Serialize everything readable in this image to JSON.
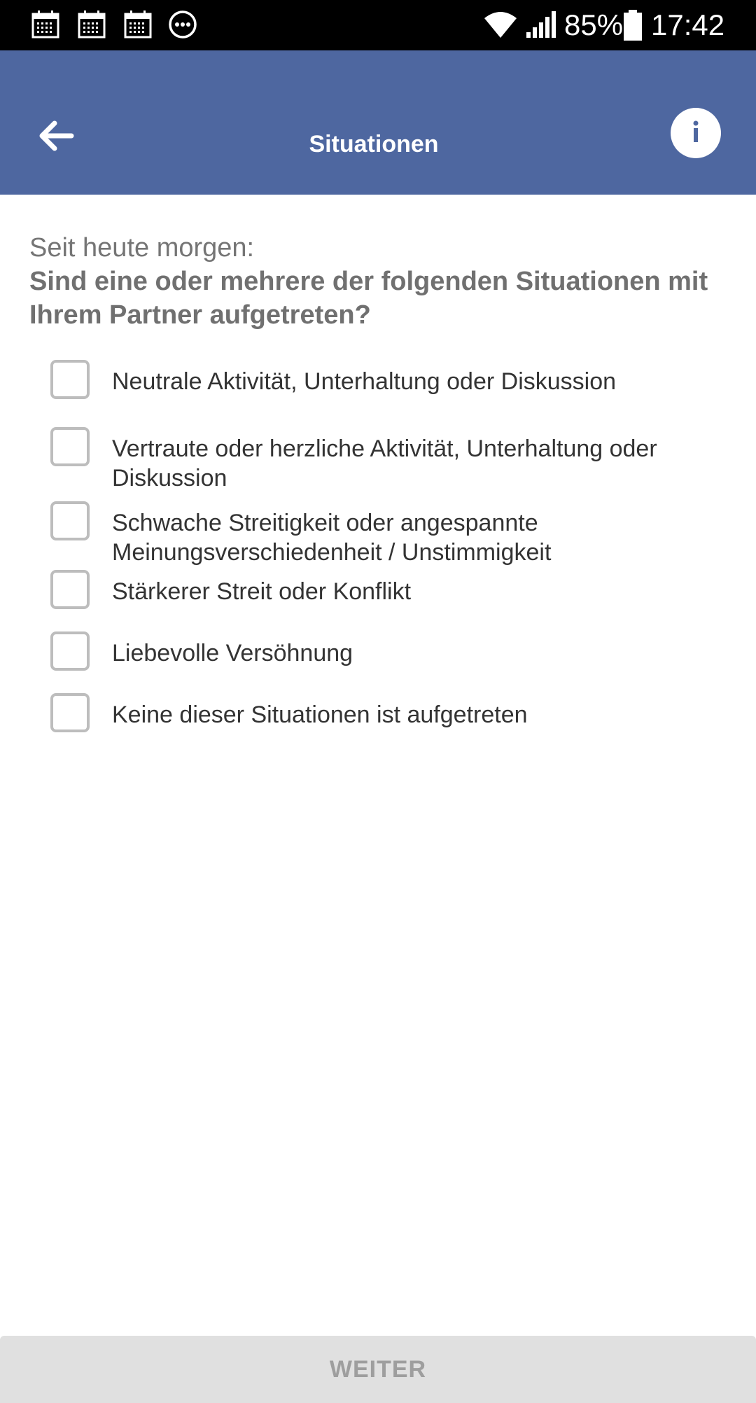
{
  "status_bar": {
    "battery_percent": "85%",
    "time": "17:42",
    "left_icons": [
      "calendar-icon",
      "calendar-icon",
      "calendar-icon",
      "more-dots-icon"
    ],
    "right_icons": [
      "wifi-icon",
      "signal-icon",
      "battery-icon"
    ]
  },
  "app_bar": {
    "title": "Situationen",
    "back_icon": "arrow-left-icon",
    "info_icon": "info-icon",
    "color": "#4e67a0"
  },
  "question": {
    "prefix": "Seit heute morgen:",
    "text": "Sind eine oder mehrere der folgenden Situationen mit Ihrem Partner aufgetreten?"
  },
  "options": [
    {
      "label": "Neutrale Aktivität, Unterhaltung oder Diskussion",
      "checked": false
    },
    {
      "label": "Vertraute oder herzliche Aktivität, Unterhaltung oder Diskussion",
      "checked": false
    },
    {
      "label": "Schwache Streitigkeit oder angespannte Meinungsverschiedenheit / Unstimmigkeit",
      "checked": false
    },
    {
      "label": "Stärkerer Streit oder Konflikt",
      "checked": false
    },
    {
      "label": "Liebevolle Versöhnung",
      "checked": false
    },
    {
      "label": "Keine dieser Situationen ist aufgetreten",
      "checked": false
    }
  ],
  "footer": {
    "next_label": "WEITER"
  }
}
